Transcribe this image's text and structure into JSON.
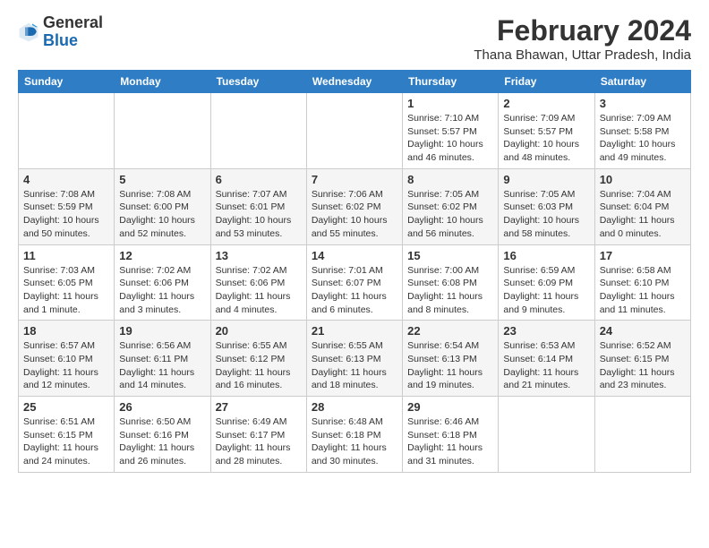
{
  "header": {
    "logo_general": "General",
    "logo_blue": "Blue",
    "month_year": "February 2024",
    "location": "Thana Bhawan, Uttar Pradesh, India"
  },
  "days_of_week": [
    "Sunday",
    "Monday",
    "Tuesday",
    "Wednesday",
    "Thursday",
    "Friday",
    "Saturday"
  ],
  "weeks": [
    [
      {
        "day": "",
        "info": ""
      },
      {
        "day": "",
        "info": ""
      },
      {
        "day": "",
        "info": ""
      },
      {
        "day": "",
        "info": ""
      },
      {
        "day": "1",
        "info": "Sunrise: 7:10 AM\nSunset: 5:57 PM\nDaylight: 10 hours\nand 46 minutes."
      },
      {
        "day": "2",
        "info": "Sunrise: 7:09 AM\nSunset: 5:57 PM\nDaylight: 10 hours\nand 48 minutes."
      },
      {
        "day": "3",
        "info": "Sunrise: 7:09 AM\nSunset: 5:58 PM\nDaylight: 10 hours\nand 49 minutes."
      }
    ],
    [
      {
        "day": "4",
        "info": "Sunrise: 7:08 AM\nSunset: 5:59 PM\nDaylight: 10 hours\nand 50 minutes."
      },
      {
        "day": "5",
        "info": "Sunrise: 7:08 AM\nSunset: 6:00 PM\nDaylight: 10 hours\nand 52 minutes."
      },
      {
        "day": "6",
        "info": "Sunrise: 7:07 AM\nSunset: 6:01 PM\nDaylight: 10 hours\nand 53 minutes."
      },
      {
        "day": "7",
        "info": "Sunrise: 7:06 AM\nSunset: 6:02 PM\nDaylight: 10 hours\nand 55 minutes."
      },
      {
        "day": "8",
        "info": "Sunrise: 7:05 AM\nSunset: 6:02 PM\nDaylight: 10 hours\nand 56 minutes."
      },
      {
        "day": "9",
        "info": "Sunrise: 7:05 AM\nSunset: 6:03 PM\nDaylight: 10 hours\nand 58 minutes."
      },
      {
        "day": "10",
        "info": "Sunrise: 7:04 AM\nSunset: 6:04 PM\nDaylight: 11 hours\nand 0 minutes."
      }
    ],
    [
      {
        "day": "11",
        "info": "Sunrise: 7:03 AM\nSunset: 6:05 PM\nDaylight: 11 hours\nand 1 minute."
      },
      {
        "day": "12",
        "info": "Sunrise: 7:02 AM\nSunset: 6:06 PM\nDaylight: 11 hours\nand 3 minutes."
      },
      {
        "day": "13",
        "info": "Sunrise: 7:02 AM\nSunset: 6:06 PM\nDaylight: 11 hours\nand 4 minutes."
      },
      {
        "day": "14",
        "info": "Sunrise: 7:01 AM\nSunset: 6:07 PM\nDaylight: 11 hours\nand 6 minutes."
      },
      {
        "day": "15",
        "info": "Sunrise: 7:00 AM\nSunset: 6:08 PM\nDaylight: 11 hours\nand 8 minutes."
      },
      {
        "day": "16",
        "info": "Sunrise: 6:59 AM\nSunset: 6:09 PM\nDaylight: 11 hours\nand 9 minutes."
      },
      {
        "day": "17",
        "info": "Sunrise: 6:58 AM\nSunset: 6:10 PM\nDaylight: 11 hours\nand 11 minutes."
      }
    ],
    [
      {
        "day": "18",
        "info": "Sunrise: 6:57 AM\nSunset: 6:10 PM\nDaylight: 11 hours\nand 12 minutes."
      },
      {
        "day": "19",
        "info": "Sunrise: 6:56 AM\nSunset: 6:11 PM\nDaylight: 11 hours\nand 14 minutes."
      },
      {
        "day": "20",
        "info": "Sunrise: 6:55 AM\nSunset: 6:12 PM\nDaylight: 11 hours\nand 16 minutes."
      },
      {
        "day": "21",
        "info": "Sunrise: 6:55 AM\nSunset: 6:13 PM\nDaylight: 11 hours\nand 18 minutes."
      },
      {
        "day": "22",
        "info": "Sunrise: 6:54 AM\nSunset: 6:13 PM\nDaylight: 11 hours\nand 19 minutes."
      },
      {
        "day": "23",
        "info": "Sunrise: 6:53 AM\nSunset: 6:14 PM\nDaylight: 11 hours\nand 21 minutes."
      },
      {
        "day": "24",
        "info": "Sunrise: 6:52 AM\nSunset: 6:15 PM\nDaylight: 11 hours\nand 23 minutes."
      }
    ],
    [
      {
        "day": "25",
        "info": "Sunrise: 6:51 AM\nSunset: 6:15 PM\nDaylight: 11 hours\nand 24 minutes."
      },
      {
        "day": "26",
        "info": "Sunrise: 6:50 AM\nSunset: 6:16 PM\nDaylight: 11 hours\nand 26 minutes."
      },
      {
        "day": "27",
        "info": "Sunrise: 6:49 AM\nSunset: 6:17 PM\nDaylight: 11 hours\nand 28 minutes."
      },
      {
        "day": "28",
        "info": "Sunrise: 6:48 AM\nSunset: 6:18 PM\nDaylight: 11 hours\nand 30 minutes."
      },
      {
        "day": "29",
        "info": "Sunrise: 6:46 AM\nSunset: 6:18 PM\nDaylight: 11 hours\nand 31 minutes."
      },
      {
        "day": "",
        "info": ""
      },
      {
        "day": "",
        "info": ""
      }
    ]
  ]
}
